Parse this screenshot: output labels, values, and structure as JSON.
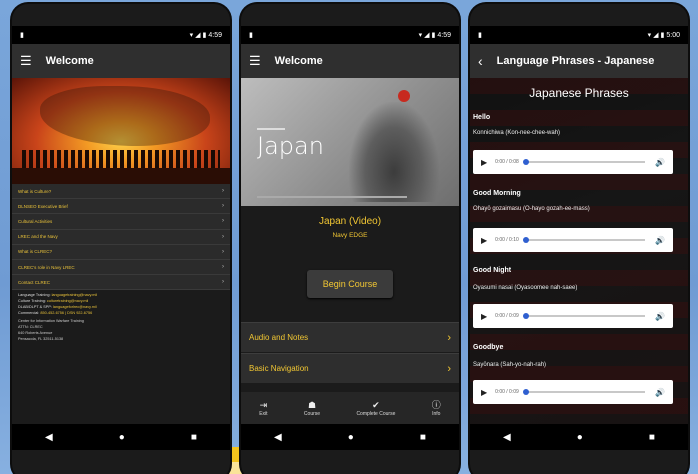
{
  "screen1": {
    "status_time": "4:59",
    "title": "Welcome",
    "menu_items": [
      "What is Culture?",
      "DLNSEO Executive Brief",
      "Cultural Activities",
      "LREC and the Navy",
      "What is CLREC?",
      "CLREC's role in Navy LREC",
      "Contact CLREC"
    ],
    "contacts": [
      {
        "label": "Language Training:",
        "value": "languagetraining@navy.mil"
      },
      {
        "label": "Culture Training:",
        "value": "culturetraining@navy.mil"
      },
      {
        "label": "DLAB/DLPT & SPP:",
        "value": "languageforlrec@navy.mil"
      },
      {
        "label": "Commercial:",
        "value": "850-452-6756 | DSN 922-6756"
      }
    ],
    "address_lines": [
      "Center for Information Warfare Training",
      "ATTN: CLREC",
      "640 Roberts Avenue",
      "Pensacola, FL 32511-5138"
    ]
  },
  "screen2": {
    "status_time": "4:59",
    "title": "Welcome",
    "hero_title": "Japan",
    "course_title": "Japan (Video)",
    "course_subtitle": "Navy EDGE",
    "begin_label": "Begin Course",
    "lessons": [
      "Audio and Notes",
      "Basic Navigation"
    ],
    "tabs": [
      {
        "label": "Exit",
        "icon": "exit-icon",
        "glyph": "⇥"
      },
      {
        "label": "Course",
        "icon": "course-icon",
        "glyph": "☗"
      },
      {
        "label": "Complete Course",
        "icon": "check-icon",
        "glyph": "✔"
      },
      {
        "label": "Info",
        "icon": "info-icon",
        "glyph": "ⓘ"
      }
    ]
  },
  "screen3": {
    "status_time": "5:00",
    "title": "Language Phrases - Japanese",
    "heading": "Japanese Phrases",
    "phrases": [
      {
        "head": "Hello",
        "text": "Konnichiwa (Kon-nee-chee-wah)",
        "time": "0:00 / 0:08"
      },
      {
        "head": "Good Morning",
        "text": "Ohayō gozaimasu (O-hayo gozah-ee-mass)",
        "time": "0:00 / 0:10"
      },
      {
        "head": "Good Night",
        "text": "Oyasumi nasai (Oyasoomee nah-saee)",
        "time": "0:00 / 0:09"
      },
      {
        "head": "Goodbye",
        "text": "Sayōnara (Sah-yo-nah-rah)",
        "time": "0:00 / 0:09"
      }
    ]
  },
  "nav": {
    "back": "◀",
    "home": "●",
    "recent": "■"
  },
  "colors": {
    "accent": "#f2c733",
    "appbar": "#2f2f2f",
    "background": "#1b1b1b"
  }
}
